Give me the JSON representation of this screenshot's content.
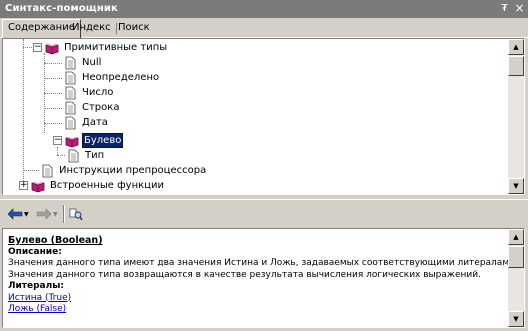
{
  "window": {
    "title": "Синтакс-помощник",
    "pin_glyph": "₮",
    "close_glyph": "×"
  },
  "tabs": [
    {
      "label": "Содержание",
      "active": true
    },
    {
      "label": "Индекс",
      "active": false
    },
    {
      "label": "Поиск",
      "active": false
    }
  ],
  "tree": {
    "items": [
      {
        "label": "Примитивные типы",
        "icon": "book-open-icon",
        "expander": "−",
        "level": 0
      },
      {
        "label": "Null",
        "icon": "page-icon",
        "level": 1
      },
      {
        "label": "Неопределено",
        "icon": "page-icon",
        "level": 1
      },
      {
        "label": "Число",
        "icon": "page-icon",
        "level": 1
      },
      {
        "label": "Строка",
        "icon": "page-icon",
        "level": 1
      },
      {
        "label": "Дата",
        "icon": "page-icon",
        "level": 1
      },
      {
        "label": "Булево",
        "icon": "book-open-icon",
        "expander": "−",
        "level": 1,
        "selected": true
      },
      {
        "label": "Тип",
        "icon": "page-icon",
        "level": 2
      },
      {
        "label": "Инструкции препроцессора",
        "icon": "page-icon",
        "level": 0
      },
      {
        "label": "Встроенные функции",
        "icon": "book-open-icon",
        "expander": "+",
        "level": 0
      }
    ]
  },
  "toolbar": {
    "back": {
      "icon": "back-arrow-icon",
      "enabled": true
    },
    "forward": {
      "icon": "forward-arrow-icon",
      "enabled": false
    },
    "find": {
      "icon": "find-in-tree-icon",
      "enabled": true
    }
  },
  "description": {
    "heading": "Булево (Boolean)",
    "desc_label": "Описание:",
    "desc_line1": "Значения данного типа имеют два значения Истина и Ложь, задаваемых соответствующими литералами.",
    "desc_line2": "Значения данного типа возвращаются в качестве результата вычисления логических выражений.",
    "literals_label": "Литералы:",
    "literal_true": "Истина (True)",
    "literal_false": "Ложь (False)"
  },
  "colors": {
    "titlebar": "#7b7b7b",
    "selection": "#0a246a",
    "link": "#0000cc",
    "book": "#c0197e"
  }
}
